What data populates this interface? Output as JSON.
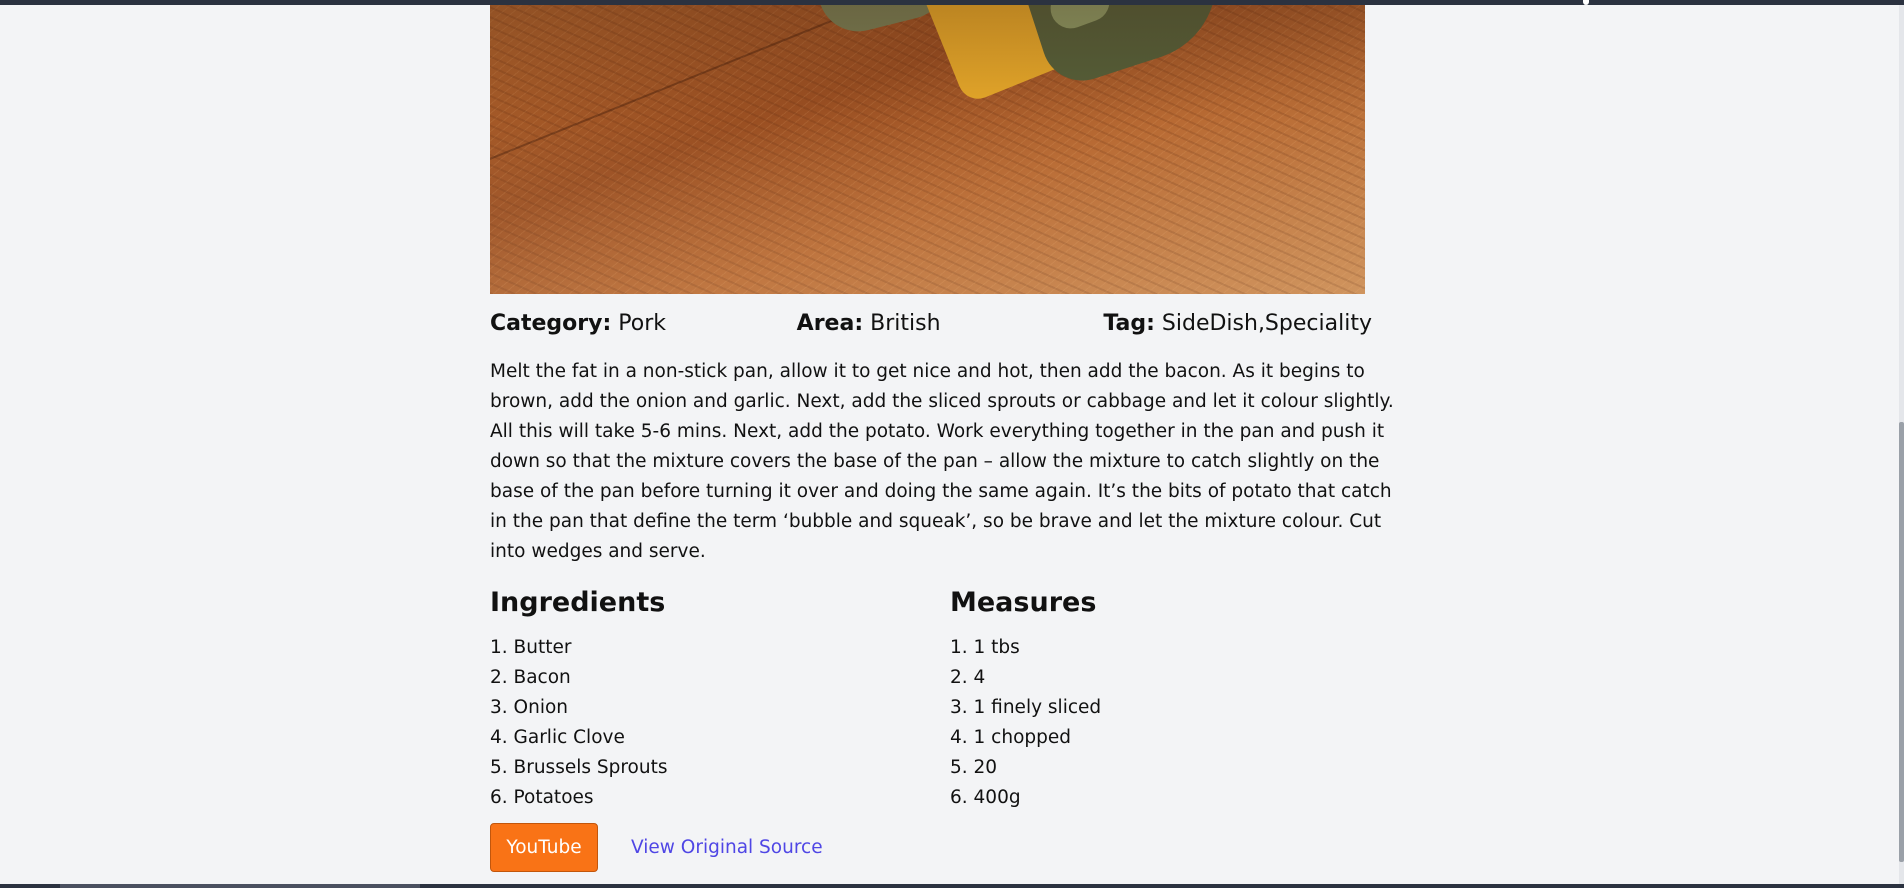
{
  "recipe": {
    "category_label": "Category:",
    "category": "Pork",
    "area_label": "Area:",
    "area": "British",
    "tag_label": "Tag:",
    "tags": "SideDish,Speciality",
    "instructions": "Melt the fat in a non-stick pan, allow it to get nice and hot, then add the bacon. As it begins to brown, add the onion and garlic. Next, add the sliced sprouts or cabbage and let it colour slightly. All this will take 5-6 mins. Next, add the potato. Work everything together in the pan and push it down so that the mixture covers the base of the pan – allow the mixture to catch slightly on the base of the pan before turning it over and doing the same again. It’s the bits of potato that catch in the pan that define the term ‘bubble and squeak’, so be brave and let the mixture colour. Cut into wedges and serve."
  },
  "ingredients": {
    "heading": "Ingredients",
    "items": [
      "1. Butter",
      "2. Bacon",
      "3. Onion",
      "4. Garlic Clove",
      "5. Brussels Sprouts",
      "6. Potatoes"
    ]
  },
  "measures": {
    "heading": "Measures",
    "items": [
      "1. 1 tbs",
      "2. 4",
      "3. 1 finely sliced",
      "4. 1 chopped",
      "5. 20",
      "6. 400g"
    ]
  },
  "actions": {
    "youtube_label": "YouTube",
    "source_label": "View Original Source"
  },
  "colors": {
    "background": "#f3f4f6",
    "youtube_button": "#f97316",
    "link": "#4f46e5"
  }
}
